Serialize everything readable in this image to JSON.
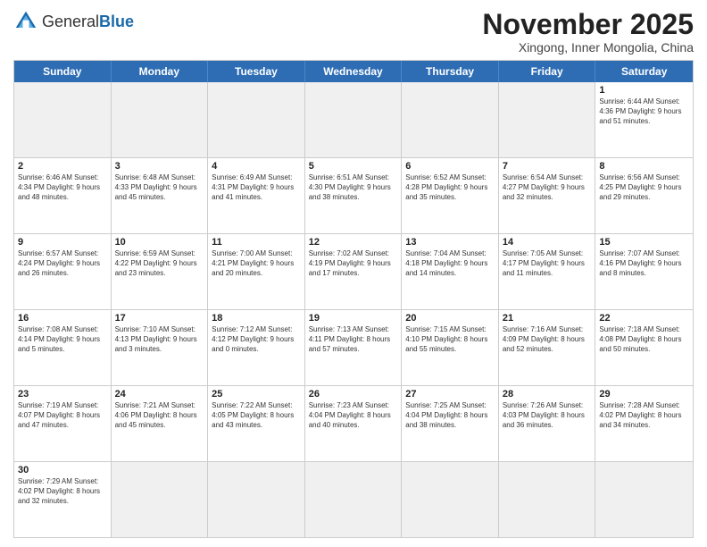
{
  "header": {
    "logo_general": "General",
    "logo_blue": "Blue",
    "month_title": "November 2025",
    "location": "Xingong, Inner Mongolia, China"
  },
  "days_of_week": [
    "Sunday",
    "Monday",
    "Tuesday",
    "Wednesday",
    "Thursday",
    "Friday",
    "Saturday"
  ],
  "weeks": [
    [
      {
        "day": "",
        "info": "",
        "empty": true
      },
      {
        "day": "",
        "info": "",
        "empty": true
      },
      {
        "day": "",
        "info": "",
        "empty": true
      },
      {
        "day": "",
        "info": "",
        "empty": true
      },
      {
        "day": "",
        "info": "",
        "empty": true
      },
      {
        "day": "",
        "info": "",
        "empty": true
      },
      {
        "day": "1",
        "info": "Sunrise: 6:44 AM\nSunset: 4:36 PM\nDaylight: 9 hours\nand 51 minutes.",
        "empty": false
      }
    ],
    [
      {
        "day": "2",
        "info": "Sunrise: 6:46 AM\nSunset: 4:34 PM\nDaylight: 9 hours\nand 48 minutes.",
        "empty": false
      },
      {
        "day": "3",
        "info": "Sunrise: 6:48 AM\nSunset: 4:33 PM\nDaylight: 9 hours\nand 45 minutes.",
        "empty": false
      },
      {
        "day": "4",
        "info": "Sunrise: 6:49 AM\nSunset: 4:31 PM\nDaylight: 9 hours\nand 41 minutes.",
        "empty": false
      },
      {
        "day": "5",
        "info": "Sunrise: 6:51 AM\nSunset: 4:30 PM\nDaylight: 9 hours\nand 38 minutes.",
        "empty": false
      },
      {
        "day": "6",
        "info": "Sunrise: 6:52 AM\nSunset: 4:28 PM\nDaylight: 9 hours\nand 35 minutes.",
        "empty": false
      },
      {
        "day": "7",
        "info": "Sunrise: 6:54 AM\nSunset: 4:27 PM\nDaylight: 9 hours\nand 32 minutes.",
        "empty": false
      },
      {
        "day": "8",
        "info": "Sunrise: 6:56 AM\nSunset: 4:25 PM\nDaylight: 9 hours\nand 29 minutes.",
        "empty": false
      }
    ],
    [
      {
        "day": "9",
        "info": "Sunrise: 6:57 AM\nSunset: 4:24 PM\nDaylight: 9 hours\nand 26 minutes.",
        "empty": false
      },
      {
        "day": "10",
        "info": "Sunrise: 6:59 AM\nSunset: 4:22 PM\nDaylight: 9 hours\nand 23 minutes.",
        "empty": false
      },
      {
        "day": "11",
        "info": "Sunrise: 7:00 AM\nSunset: 4:21 PM\nDaylight: 9 hours\nand 20 minutes.",
        "empty": false
      },
      {
        "day": "12",
        "info": "Sunrise: 7:02 AM\nSunset: 4:19 PM\nDaylight: 9 hours\nand 17 minutes.",
        "empty": false
      },
      {
        "day": "13",
        "info": "Sunrise: 7:04 AM\nSunset: 4:18 PM\nDaylight: 9 hours\nand 14 minutes.",
        "empty": false
      },
      {
        "day": "14",
        "info": "Sunrise: 7:05 AM\nSunset: 4:17 PM\nDaylight: 9 hours\nand 11 minutes.",
        "empty": false
      },
      {
        "day": "15",
        "info": "Sunrise: 7:07 AM\nSunset: 4:16 PM\nDaylight: 9 hours\nand 8 minutes.",
        "empty": false
      }
    ],
    [
      {
        "day": "16",
        "info": "Sunrise: 7:08 AM\nSunset: 4:14 PM\nDaylight: 9 hours\nand 5 minutes.",
        "empty": false
      },
      {
        "day": "17",
        "info": "Sunrise: 7:10 AM\nSunset: 4:13 PM\nDaylight: 9 hours\nand 3 minutes.",
        "empty": false
      },
      {
        "day": "18",
        "info": "Sunrise: 7:12 AM\nSunset: 4:12 PM\nDaylight: 9 hours\nand 0 minutes.",
        "empty": false
      },
      {
        "day": "19",
        "info": "Sunrise: 7:13 AM\nSunset: 4:11 PM\nDaylight: 8 hours\nand 57 minutes.",
        "empty": false
      },
      {
        "day": "20",
        "info": "Sunrise: 7:15 AM\nSunset: 4:10 PM\nDaylight: 8 hours\nand 55 minutes.",
        "empty": false
      },
      {
        "day": "21",
        "info": "Sunrise: 7:16 AM\nSunset: 4:09 PM\nDaylight: 8 hours\nand 52 minutes.",
        "empty": false
      },
      {
        "day": "22",
        "info": "Sunrise: 7:18 AM\nSunset: 4:08 PM\nDaylight: 8 hours\nand 50 minutes.",
        "empty": false
      }
    ],
    [
      {
        "day": "23",
        "info": "Sunrise: 7:19 AM\nSunset: 4:07 PM\nDaylight: 8 hours\nand 47 minutes.",
        "empty": false
      },
      {
        "day": "24",
        "info": "Sunrise: 7:21 AM\nSunset: 4:06 PM\nDaylight: 8 hours\nand 45 minutes.",
        "empty": false
      },
      {
        "day": "25",
        "info": "Sunrise: 7:22 AM\nSunset: 4:05 PM\nDaylight: 8 hours\nand 43 minutes.",
        "empty": false
      },
      {
        "day": "26",
        "info": "Sunrise: 7:23 AM\nSunset: 4:04 PM\nDaylight: 8 hours\nand 40 minutes.",
        "empty": false
      },
      {
        "day": "27",
        "info": "Sunrise: 7:25 AM\nSunset: 4:04 PM\nDaylight: 8 hours\nand 38 minutes.",
        "empty": false
      },
      {
        "day": "28",
        "info": "Sunrise: 7:26 AM\nSunset: 4:03 PM\nDaylight: 8 hours\nand 36 minutes.",
        "empty": false
      },
      {
        "day": "29",
        "info": "Sunrise: 7:28 AM\nSunset: 4:02 PM\nDaylight: 8 hours\nand 34 minutes.",
        "empty": false
      }
    ],
    [
      {
        "day": "30",
        "info": "Sunrise: 7:29 AM\nSunset: 4:02 PM\nDaylight: 8 hours\nand 32 minutes.",
        "empty": false
      },
      {
        "day": "",
        "info": "",
        "empty": true
      },
      {
        "day": "",
        "info": "",
        "empty": true
      },
      {
        "day": "",
        "info": "",
        "empty": true
      },
      {
        "day": "",
        "info": "",
        "empty": true
      },
      {
        "day": "",
        "info": "",
        "empty": true
      },
      {
        "day": "",
        "info": "",
        "empty": true
      }
    ]
  ]
}
